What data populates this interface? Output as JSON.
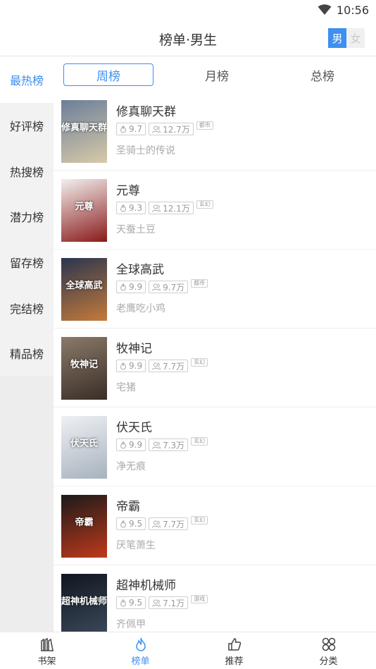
{
  "status": {
    "time": "10:56"
  },
  "header": {
    "title": "榜单·男生",
    "gender_male": "男",
    "gender_female": "女"
  },
  "sidebar": {
    "items": [
      {
        "label": "最热榜",
        "active": true
      },
      {
        "label": "好评榜"
      },
      {
        "label": "热搜榜"
      },
      {
        "label": "潜力榜"
      },
      {
        "label": "留存榜"
      },
      {
        "label": "完结榜"
      },
      {
        "label": "精品榜"
      }
    ]
  },
  "tabs": [
    {
      "label": "周榜",
      "active": true
    },
    {
      "label": "月榜"
    },
    {
      "label": "总榜"
    }
  ],
  "books": [
    {
      "title": "修真聊天群",
      "score": "9.7",
      "readers": "12.7万",
      "category": "都市",
      "author": "圣骑士的传说",
      "cover_text": "修真聊天群",
      "cover_colors": [
        "#6b7f9a",
        "#d8c9a8"
      ]
    },
    {
      "title": "元尊",
      "score": "9.3",
      "readers": "12.1万",
      "category": "玄幻",
      "author": "天蚕土豆",
      "cover_text": "元尊",
      "cover_colors": [
        "#f2f0ee",
        "#8a1a1a"
      ]
    },
    {
      "title": "全球高武",
      "score": "9.9",
      "readers": "9.7万",
      "category": "都市",
      "author": "老鹰吃小鸡",
      "cover_text": "全球高武",
      "cover_colors": [
        "#2b3550",
        "#c47a3a"
      ]
    },
    {
      "title": "牧神记",
      "score": "9.9",
      "readers": "7.7万",
      "category": "玄幻",
      "author": "宅猪",
      "cover_text": "牧神记",
      "cover_colors": [
        "#8a7a6a",
        "#3a2e26"
      ]
    },
    {
      "title": "伏天氏",
      "score": "9.9",
      "readers": "7.3万",
      "category": "玄幻",
      "author": "净无痕",
      "cover_text": "伏天氏",
      "cover_colors": [
        "#eef1f4",
        "#a7b2bd"
      ]
    },
    {
      "title": "帝霸",
      "score": "9.5",
      "readers": "7.7万",
      "category": "玄幻",
      "author": "厌笔萧生",
      "cover_text": "帝霸",
      "cover_colors": [
        "#1a1a1a",
        "#c0391b"
      ]
    },
    {
      "title": "超神机械师",
      "score": "9.5",
      "readers": "7.1万",
      "category": "游戏",
      "author": "齐佩甲",
      "cover_text": "超神机械师",
      "cover_colors": [
        "#10161f",
        "#3c4a5c"
      ]
    }
  ],
  "bottom_nav": [
    {
      "label": "书架",
      "icon": "bookshelf-icon"
    },
    {
      "label": "榜单",
      "icon": "flame-icon",
      "active": true
    },
    {
      "label": "推荐",
      "icon": "thumbs-up-icon"
    },
    {
      "label": "分类",
      "icon": "grid-icon"
    }
  ],
  "colors": {
    "accent": "#3d8ff0"
  }
}
